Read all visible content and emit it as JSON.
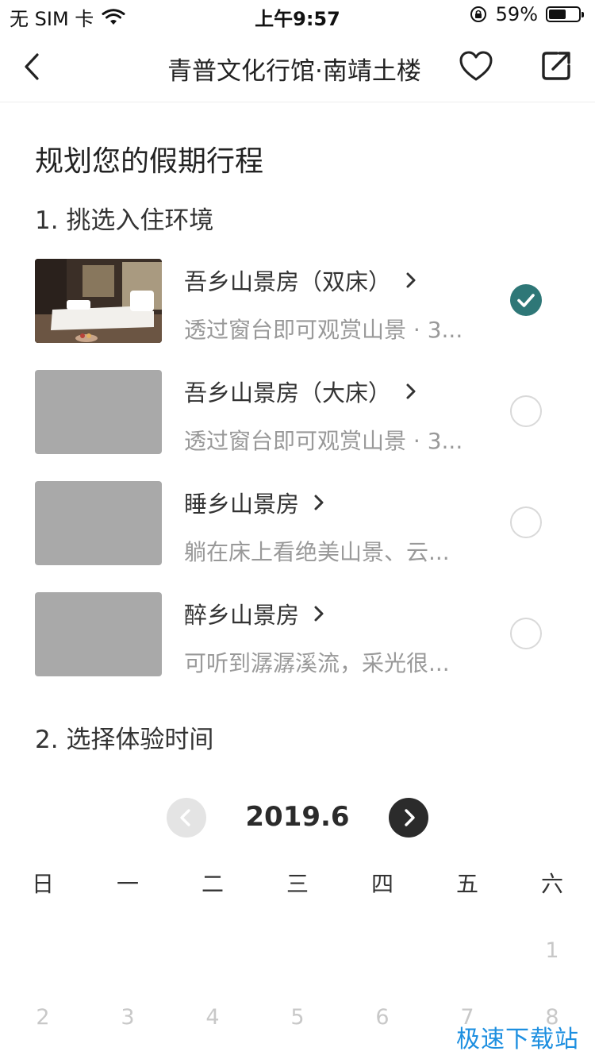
{
  "status_bar": {
    "carrier": "无 SIM 卡",
    "time": "上午9:57",
    "battery_percent_text": "59%",
    "battery_level": 0.59,
    "icons": [
      "wifi-icon",
      "orientation-lock-icon",
      "battery-icon"
    ]
  },
  "nav": {
    "title": "青普文化行馆·南靖土楼",
    "icons": [
      "back-icon",
      "heart-icon",
      "share-icon"
    ]
  },
  "page": {
    "section_title": "规划您的假期行程",
    "step1_title": "1. 挑选入住环境",
    "step2_title": "2. 选择体验时间"
  },
  "rooms": [
    {
      "name": "吾乡山景房（双床）",
      "desc": "透过窗台即可观赏山景 · 3...",
      "selected": true
    },
    {
      "name": "吾乡山景房（大床）",
      "desc": "透过窗台即可观赏山景 · 3...",
      "selected": false
    },
    {
      "name": "睡乡山景房",
      "desc": "躺在床上看绝美山景、云...",
      "selected": false
    },
    {
      "name": "醉乡山景房",
      "desc": "可听到潺潺溪流，采光很...",
      "selected": false
    }
  ],
  "calendar": {
    "month": "2019.6",
    "weekdays": [
      "日",
      "一",
      "二",
      "三",
      "四",
      "五",
      "六"
    ],
    "row1": [
      "1"
    ],
    "row2": [
      "2",
      "3",
      "4",
      "5",
      "6",
      "7",
      "8"
    ]
  },
  "colors": {
    "accent": "#2e7777",
    "disabled_day": "#c8c8c8",
    "placeholder_thumb": "#a9a9a9"
  },
  "watermark": "极速下载站"
}
